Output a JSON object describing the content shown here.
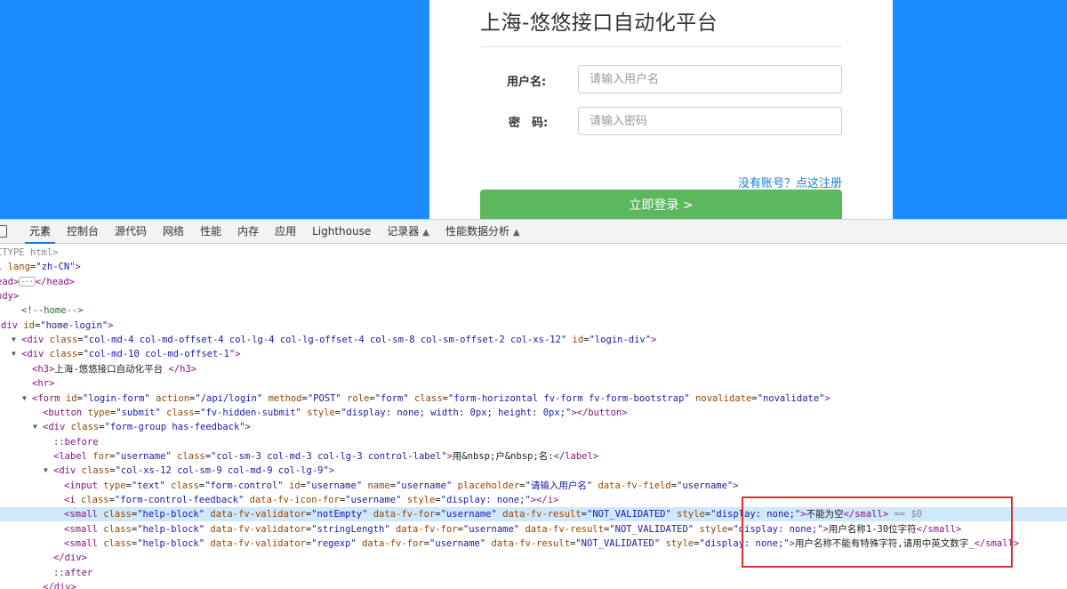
{
  "login": {
    "title": "上海-悠悠接口自动化平台",
    "username_label": "用户名:",
    "username_placeholder": "请输入用户名",
    "password_label": "密　码:",
    "password_placeholder": "请输入密码",
    "register_link": "没有账号？点这注册",
    "login_button": "立即登录 >"
  },
  "devtools": {
    "tabs": [
      {
        "label": "元素",
        "active": true
      },
      {
        "label": "控制台"
      },
      {
        "label": "源代码"
      },
      {
        "label": "网络"
      },
      {
        "label": "性能"
      },
      {
        "label": "内存"
      },
      {
        "label": "应用"
      },
      {
        "label": "Lighthouse"
      },
      {
        "label": "记录器",
        "flask": true
      },
      {
        "label": "性能数据分析",
        "flask": true
      }
    ],
    "lines": [
      {
        "indent": -2,
        "html": "<span class='tok-doc'>CTYPE html&gt;</span>"
      },
      {
        "indent": -2,
        "html": "<span class='tok-tag'>l</span> <span class='tok-attr'>lang</span>=<span class='tok-val'>\"zh-CN\"</span><span class='tok-tag'>&gt;</span>"
      },
      {
        "indent": -2,
        "html": "<span class='tok-tag'>ead&gt;</span><span class='ellipsis-badge'>···</span><span class='tok-tag'>&lt;/head&gt;</span>"
      },
      {
        "indent": -2,
        "html": "<span class='tok-tag'>ody&gt;</span>"
      },
      {
        "indent": 0,
        "html": "<span class='tok-com'>&lt;!--home--&gt;</span>"
      },
      {
        "indent": -1,
        "html": "<span class='tok-tag'>div</span> <span class='tok-attr'>id</span>=<span class='tok-val'>\"home-login\"</span><span class='tok-tag'>&gt;</span>"
      },
      {
        "indent": 0,
        "tri": true,
        "html": "<span class='tok-tag'>&lt;div</span> <span class='tok-attr'>class</span>=<span class='tok-val'>\"col-md-4 col-md-offset-4 col-lg-4 col-lg-offset-4 col-sm-8 col-sm-offset-2 col-xs-12\"</span> <span class='tok-attr'>id</span>=<span class='tok-val'>\"login-div\"</span><span class='tok-tag'>&gt;</span>"
      },
      {
        "indent": 1,
        "tri": true,
        "html": "<span class='tok-tag'>&lt;div</span> <span class='tok-attr'>class</span>=<span class='tok-val'>\"col-md-10 col-md-offset-1\"</span><span class='tok-tag'>&gt;</span>"
      },
      {
        "indent": 2,
        "html": "<span class='tok-tag'>&lt;h3&gt;</span><span class='tok-txt'>上海-悠悠接口自动化平台 </span><span class='tok-tag'>&lt;/h3&gt;</span>"
      },
      {
        "indent": 2,
        "html": "<span class='tok-tag'>&lt;hr&gt;</span>"
      },
      {
        "indent": 2,
        "tri": true,
        "html": "<span class='tok-tag'>&lt;form</span> <span class='tok-attr'>id</span>=<span class='tok-val'>\"login-form\"</span> <span class='tok-attr'>action</span>=<span class='tok-val'>\"/api/login\"</span> <span class='tok-attr'>method</span>=<span class='tok-val'>\"POST\"</span> <span class='tok-attr'>role</span>=<span class='tok-val'>\"form\"</span> <span class='tok-attr'>class</span>=<span class='tok-val'>\"form-horizontal fv-form fv-form-bootstrap\"</span> <span class='tok-attr'>novalidate</span>=<span class='tok-val'>\"novalidate\"</span><span class='tok-tag'>&gt;</span>"
      },
      {
        "indent": 3,
        "html": "<span class='tok-tag'>&lt;button</span> <span class='tok-attr'>type</span>=<span class='tok-val'>\"submit\"</span> <span class='tok-attr'>class</span>=<span class='tok-val'>\"fv-hidden-submit\"</span> <span class='tok-attr'>style</span>=<span class='tok-val'>\"display: none; width: 0px; height: 0px;\"</span><span class='tok-tag'>&gt;&lt;/button&gt;</span>"
      },
      {
        "indent": 3,
        "tri": true,
        "html": "<span class='tok-tag'>&lt;div</span> <span class='tok-attr'>class</span>=<span class='tok-val'>\"form-group has-feedback\"</span><span class='tok-tag'>&gt;</span>"
      },
      {
        "indent": 4,
        "html": "<span class='tok-pseudo'>::before</span>"
      },
      {
        "indent": 4,
        "html": "<span class='tok-tag'>&lt;label</span> <span class='tok-attr'>for</span>=<span class='tok-val'>\"username\"</span> <span class='tok-attr'>class</span>=<span class='tok-val'>\"col-sm-3 col-md-3 col-lg-3 control-label\"</span><span class='tok-tag'>&gt;</span><span class='tok-txt'>用&amp;nbsp;户&amp;nbsp;名:</span><span class='tok-tag'>&lt;/label&gt;</span>"
      },
      {
        "indent": 4,
        "tri": true,
        "html": "<span class='tok-tag'>&lt;div</span> <span class='tok-attr'>class</span>=<span class='tok-val'>\"col-xs-12 col-sm-9 col-md-9 col-lg-9\"</span><span class='tok-tag'>&gt;</span>"
      },
      {
        "indent": 5,
        "html": "<span class='tok-tag'>&lt;input</span> <span class='tok-attr'>type</span>=<span class='tok-val'>\"text\"</span> <span class='tok-attr'>class</span>=<span class='tok-val'>\"form-control\"</span> <span class='tok-attr'>id</span>=<span class='tok-val'>\"username\"</span> <span class='tok-attr'>name</span>=<span class='tok-val'>\"username\"</span> <span class='tok-attr'>placeholder</span>=<span class='tok-val'>\"请输入用户名\"</span> <span class='tok-attr'>data-fv-field</span>=<span class='tok-val'>\"username\"</span><span class='tok-tag'>&gt;</span>"
      },
      {
        "indent": 5,
        "html": "<span class='tok-tag'>&lt;i</span> <span class='tok-attr'>class</span>=<span class='tok-val'>\"form-control-feedback\"</span> <span class='tok-attr'>data-fv-icon-for</span>=<span class='tok-val'>\"username\"</span> <span class='tok-attr'>style</span>=<span class='tok-val'>\"display: none;\"</span><span class='tok-tag'>&gt;&lt;/i&gt;</span>"
      },
      {
        "indent": 5,
        "highlight": true,
        "html": "<span class='tok-tag'>&lt;small</span> <span class='tok-attr'>class</span>=<span class='tok-val'>\"help-block\"</span> <span class='tok-attr'>data-fv-validator</span>=<span class='tok-val'>\"notEmpty\"</span> <span class='tok-attr'>data-fv-for</span>=<span class='tok-val'>\"username\"</span> <span class='tok-attr'>data-fv-result</span>=<span class='tok-val'>\"NOT_VALIDATED\"</span> <span class='tok-attr'>style</span>=<span class='tok-val'>\"display: none;\"</span><span class='tok-tag'>&gt;</span><span class='tok-txt'>不能为空</span><span class='tok-tag'>&lt;/small&gt;</span> <span class='tok-eq'>== $0</span>"
      },
      {
        "indent": 5,
        "html": "<span class='tok-tag'>&lt;small</span> <span class='tok-attr'>class</span>=<span class='tok-val'>\"help-block\"</span> <span class='tok-attr'>data-fv-validator</span>=<span class='tok-val'>\"stringLength\"</span> <span class='tok-attr'>data-fv-for</span>=<span class='tok-val'>\"username\"</span> <span class='tok-attr'>data-fv-result</span>=<span class='tok-val'>\"NOT_VALIDATED\"</span> <span class='tok-attr'>style</span>=<span class='tok-val'>\"display: none;\"</span><span class='tok-tag'>&gt;</span><span class='tok-txt'>用户名称1-30位字符</span><span class='tok-tag'>&lt;/small&gt;</span>"
      },
      {
        "indent": 5,
        "html": "<span class='tok-tag'>&lt;small</span> <span class='tok-attr'>class</span>=<span class='tok-val'>\"help-block\"</span> <span class='tok-attr'>data-fv-validator</span>=<span class='tok-val'>\"regexp\"</span> <span class='tok-attr'>data-fv-for</span>=<span class='tok-val'>\"username\"</span> <span class='tok-attr'>data-fv-result</span>=<span class='tok-val'>\"NOT_VALIDATED\"</span> <span class='tok-attr'>style</span>=<span class='tok-val'>\"display: none;\"</span><span class='tok-tag'>&gt;</span><span class='tok-txt'>用户名称不能有特殊字符,请用中英文数字_</span><span class='tok-tag'>&lt;/small&gt;</span>"
      },
      {
        "indent": 4,
        "html": "<span class='tok-tag'>&lt;/div&gt;</span>"
      },
      {
        "indent": 4,
        "html": "<span class='tok-pseudo'>::after</span>"
      },
      {
        "indent": 3,
        "html": "<span class='tok-tag'>&lt;/div&gt;</span>"
      }
    ]
  },
  "annotation": {
    "color": "#e0302e"
  }
}
